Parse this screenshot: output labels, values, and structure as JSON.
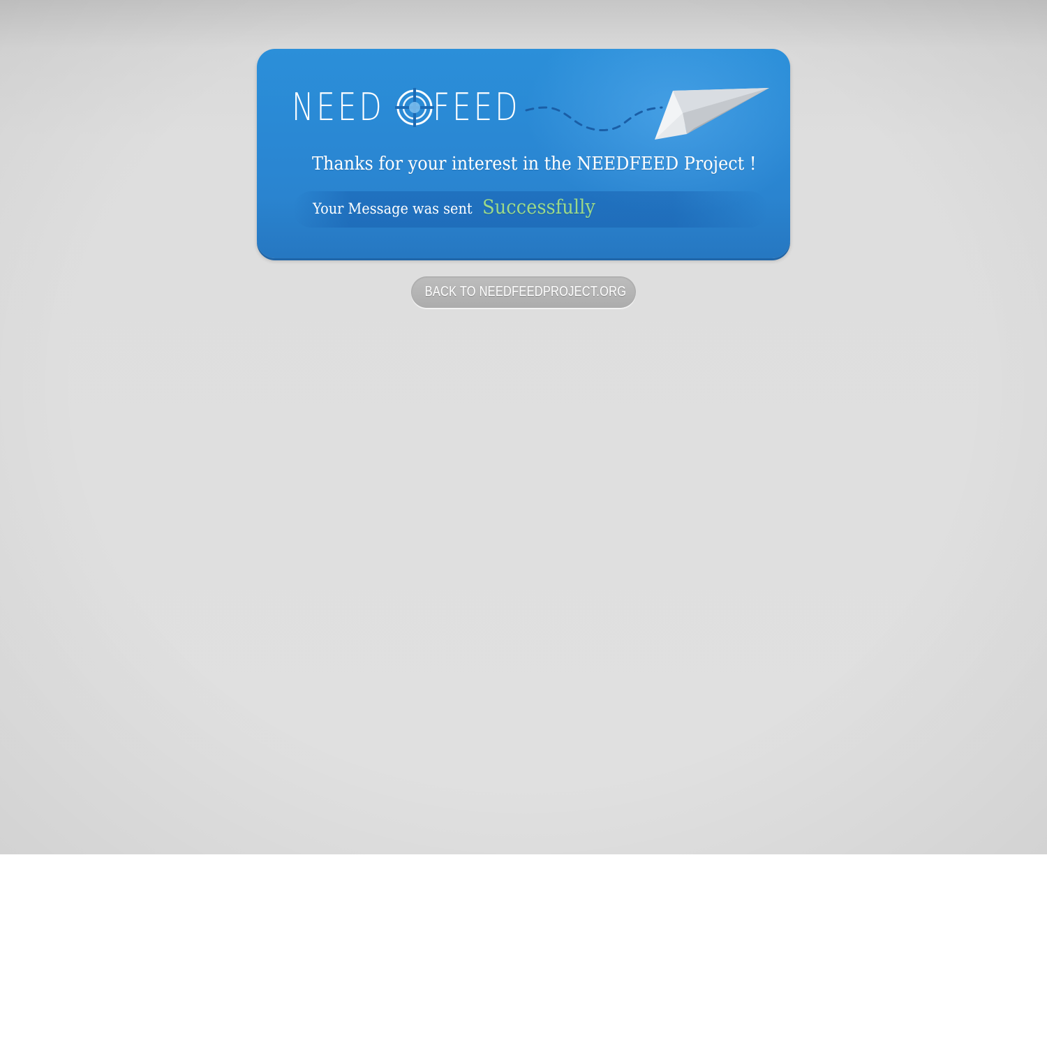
{
  "logo": {
    "left_word": "NEED",
    "right_word": "FEED",
    "icon": "target-icon"
  },
  "message": {
    "thanks": "Thanks for your interest in the NEEDFEED Project !",
    "sent_prefix": "Your Message was sent",
    "sent_status": "Successfully"
  },
  "back_button": {
    "label": "BACK TO NEEDFEEDPROJECT.ORG",
    "icon": "arrow-left-icon"
  },
  "colors": {
    "card_blue": "#2a87d3",
    "success_green": "#9bd98a",
    "button_gray": "#b4b4b4",
    "page_background": "#e0e0e0"
  },
  "decor": {
    "plane": "paper-plane-icon",
    "trail": "dashed-flight-trail"
  }
}
